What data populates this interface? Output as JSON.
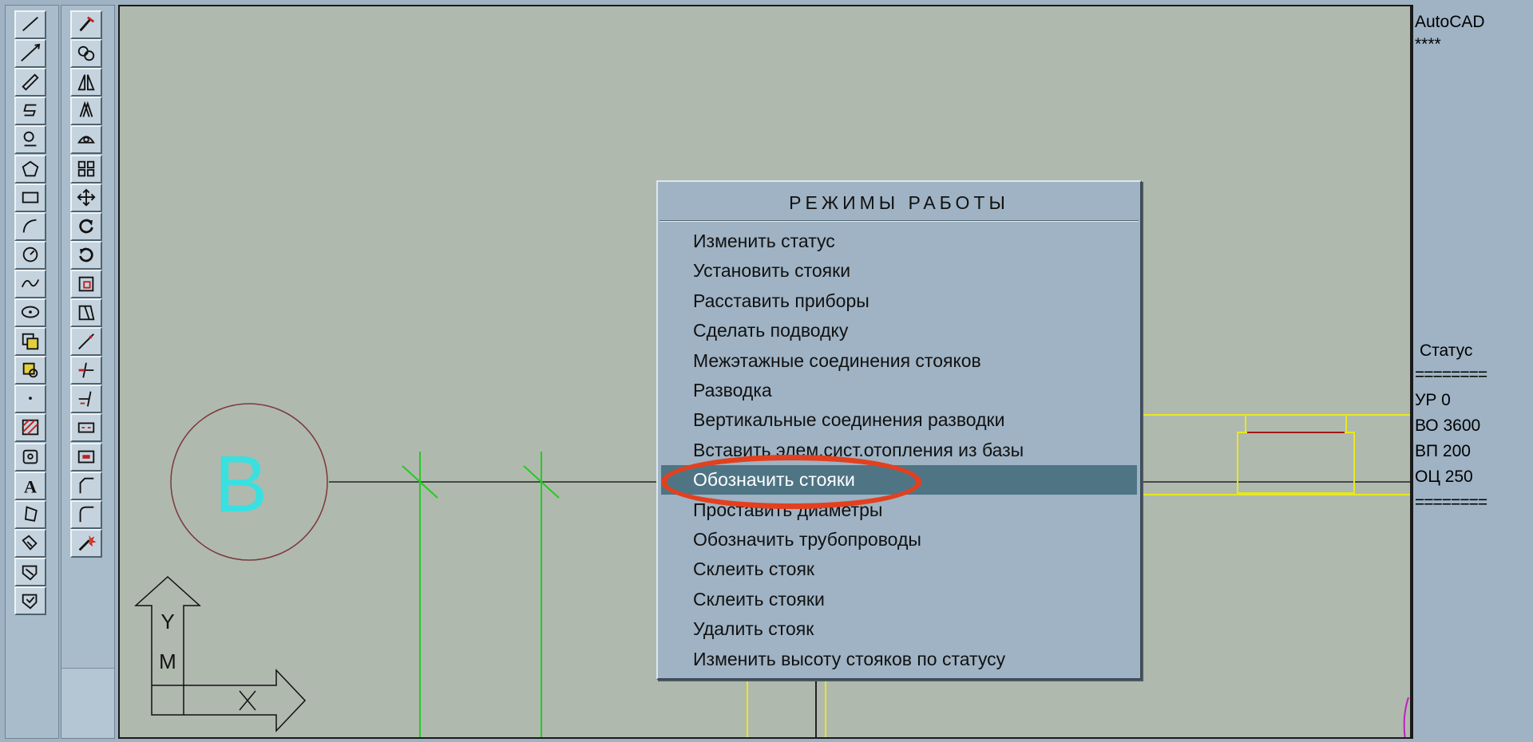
{
  "toolbars": {
    "draw": [
      "line-icon",
      "construction-line-icon",
      "polyline-icon",
      "multiline-icon",
      "3d-polyline-icon",
      "polygon-icon",
      "rectangle-icon",
      "arc-icon",
      "circle-icon",
      "spline-icon",
      "ellipse-icon",
      "insert-block-icon",
      "make-block-icon",
      "point-icon",
      "hatch-icon",
      "region-icon",
      "text-icon",
      "dimension-icon",
      "leader-icon",
      "tolerance-icon",
      "center-mark-icon"
    ],
    "modify": [
      "erase-icon",
      "copy-icon",
      "mirror-icon",
      "offset-icon",
      "array-icon",
      "array-grid-icon",
      "move-icon",
      "rotate-icon",
      "rotate-3d-icon",
      "scale-icon",
      "stretch-icon",
      "lengthen-icon",
      "trim-icon",
      "extend-icon",
      "break-icon",
      "break-at-point-icon",
      "chamfer-icon",
      "fillet-icon",
      "explode-icon"
    ]
  },
  "drawing": {
    "grid_bubble_label": "B",
    "ucs_icon": {
      "y_label": "Y",
      "x_label": "X",
      "m_label": "M"
    }
  },
  "side_panel": {
    "app_title": "AutoCAD",
    "stars": "****",
    "status_heading": "Статус",
    "separator": "========",
    "values": [
      "УР 0",
      "ВО 3600",
      "ВП 200",
      "ОЦ 250"
    ],
    "separator_bottom": "========"
  },
  "popup": {
    "title": "РЕЖИМЫ РАБОТЫ",
    "items": [
      "Изменить статус",
      "Установить стояки",
      "Расставить приборы",
      "Сделать подводку",
      "Межэтажные соединения стояков",
      "Разводка",
      "Вертикальные соединения разводки",
      "Вставить элем.сист.отопления из базы",
      "Обозначить стояки",
      "Проставить диаметры",
      "Обозначить трубопроводы",
      "Склеить стояк",
      "Склеить стояки",
      "Удалить стояк",
      "Изменить высоту стояков по статусу"
    ],
    "selected_index": 8
  },
  "colors": {
    "canvas_bg": "#b0b9ae",
    "panel_bg": "#9fb3c4",
    "selected_bg": "#4f7585",
    "highlight": "#e2401f",
    "riser_green": "#22cc22",
    "pipe_yellow": "#e8e820"
  }
}
